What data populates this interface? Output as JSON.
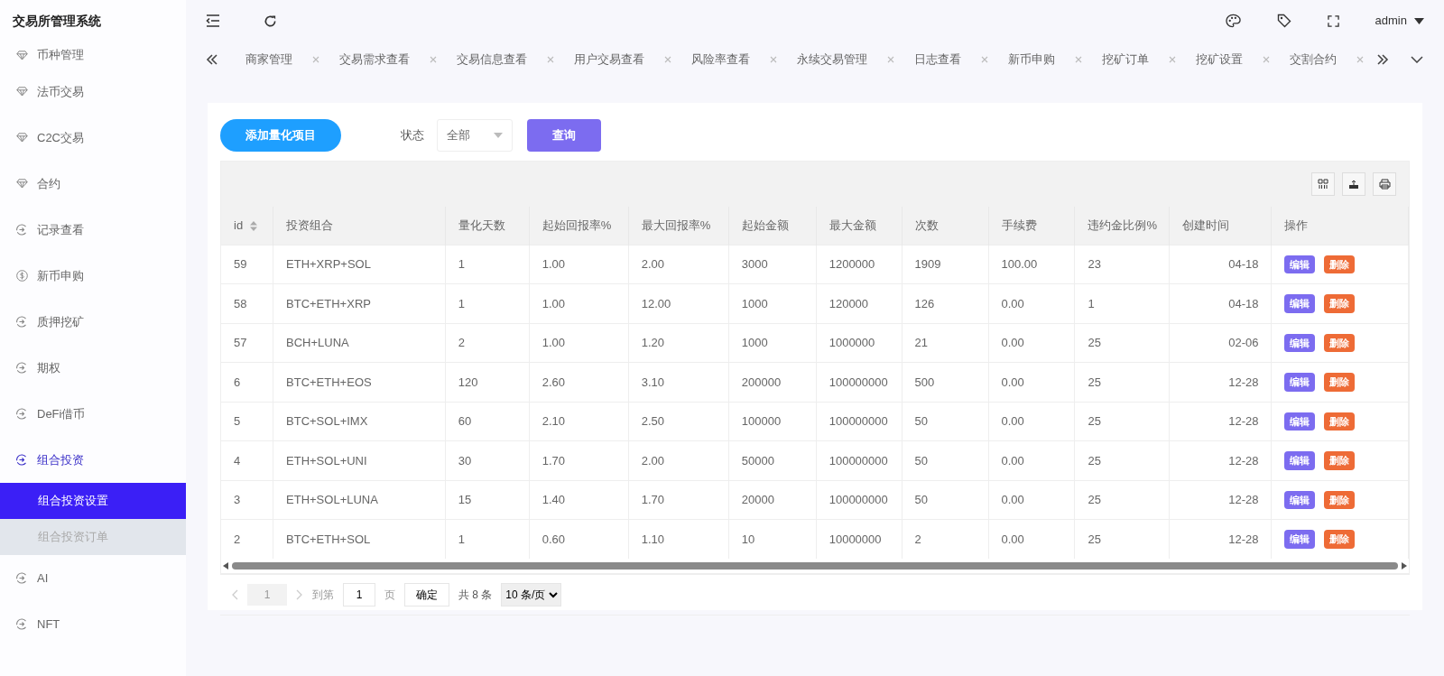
{
  "app_title": "交易所管理系统",
  "header": {
    "user": "admin"
  },
  "tabs": [
    {
      "label": "商家管理"
    },
    {
      "label": "交易需求查看"
    },
    {
      "label": "交易信息查看"
    },
    {
      "label": "用户交易查看"
    },
    {
      "label": "风险率查看"
    },
    {
      "label": "永续交易管理"
    },
    {
      "label": "日志查看"
    },
    {
      "label": "新币申购"
    },
    {
      "label": "挖矿订单"
    },
    {
      "label": "挖矿设置"
    },
    {
      "label": "交割合约"
    }
  ],
  "sidebar": {
    "items": [
      {
        "label": "币种管理",
        "kind": "diamond",
        "selected": false
      },
      {
        "label": "法币交易",
        "kind": "diamond",
        "selected": false
      },
      {
        "label": "C2C交易",
        "kind": "diamond",
        "selected": false
      },
      {
        "label": "合约",
        "kind": "diamond",
        "selected": false
      },
      {
        "label": "记录查看",
        "kind": "enter",
        "selected": false
      },
      {
        "label": "新币申购",
        "kind": "dollar",
        "selected": false
      },
      {
        "label": "质押挖矿",
        "kind": "enter",
        "selected": false
      },
      {
        "label": "期权",
        "kind": "enter",
        "selected": false
      },
      {
        "label": "DeFi借币",
        "kind": "enter",
        "selected": false
      },
      {
        "label": "组合投资",
        "kind": "enter",
        "selected": true,
        "children": [
          {
            "label": "组合投资设置",
            "selected": true
          },
          {
            "label": "组合投资订单",
            "selected": false
          }
        ]
      },
      {
        "label": "AI",
        "kind": "enter",
        "selected": false
      },
      {
        "label": "NFT",
        "kind": "enter",
        "selected": false
      }
    ]
  },
  "toolbar": {
    "add_button": "添加量化项目",
    "status_label": "状态",
    "status_value": "全部",
    "query_button": "查询"
  },
  "table": {
    "columns": [
      {
        "label": "id",
        "sortable": true
      },
      {
        "label": "投资组合",
        "sortable": false
      },
      {
        "label": "量化天数",
        "sortable": false
      },
      {
        "label": "起始回报率%",
        "sortable": false
      },
      {
        "label": "最大回报率%",
        "sortable": false
      },
      {
        "label": "起始金额",
        "sortable": false
      },
      {
        "label": "最大金额",
        "sortable": false
      },
      {
        "label": "次数",
        "sortable": false
      },
      {
        "label": "手续费",
        "sortable": false
      },
      {
        "label": "违约金比例%",
        "sortable": false
      },
      {
        "label": "创建时间",
        "sortable": false
      },
      {
        "label": "操作",
        "sortable": false
      }
    ],
    "rows": [
      {
        "cells": [
          "59",
          "ETH+XRP+SOL",
          "1",
          "1.00",
          "2.00",
          "3000",
          "1200000",
          "1909",
          "100.00",
          "23",
          "04-18"
        ],
        "actions": [
          "编辑",
          "删除"
        ]
      },
      {
        "cells": [
          "58",
          "BTC+ETH+XRP",
          "1",
          "1.00",
          "12.00",
          "1000",
          "120000",
          "126",
          "0.00",
          "1",
          "04-18"
        ],
        "actions": [
          "编辑",
          "删除"
        ]
      },
      {
        "cells": [
          "57",
          "BCH+LUNA",
          "2",
          "1.00",
          "1.20",
          "1000",
          "1000000",
          "21",
          "0.00",
          "25",
          "02-06"
        ],
        "actions": [
          "编辑",
          "删除"
        ]
      },
      {
        "cells": [
          "6",
          "BTC+ETH+EOS",
          "120",
          "2.60",
          "3.10",
          "200000",
          "100000000",
          "500",
          "0.00",
          "25",
          "12-28"
        ],
        "actions": [
          "编辑",
          "删除"
        ]
      },
      {
        "cells": [
          "5",
          "BTC+SOL+IMX",
          "60",
          "2.10",
          "2.50",
          "100000",
          "100000000",
          "50",
          "0.00",
          "25",
          "12-28"
        ],
        "actions": [
          "编辑",
          "删除"
        ]
      },
      {
        "cells": [
          "4",
          "ETH+SOL+UNI",
          "30",
          "1.70",
          "2.00",
          "50000",
          "100000000",
          "50",
          "0.00",
          "25",
          "12-28"
        ],
        "actions": [
          "编辑",
          "删除"
        ]
      },
      {
        "cells": [
          "3",
          "ETH+SOL+LUNA",
          "15",
          "1.40",
          "1.70",
          "20000",
          "100000000",
          "50",
          "0.00",
          "25",
          "12-28"
        ],
        "actions": [
          "编辑",
          "删除"
        ]
      },
      {
        "cells": [
          "2",
          "BTC+ETH+SOL",
          "1",
          "0.60",
          "1.10",
          "10",
          "10000000",
          "2",
          "0.00",
          "25",
          "12-28"
        ],
        "actions": [
          "编辑",
          "删除"
        ]
      }
    ]
  },
  "pagination": {
    "page": "1",
    "goto_label": "到第",
    "goto_value": "1",
    "page_unit": "页",
    "confirm": "确定",
    "total": "共 8 条",
    "page_size": "10 条/页"
  }
}
